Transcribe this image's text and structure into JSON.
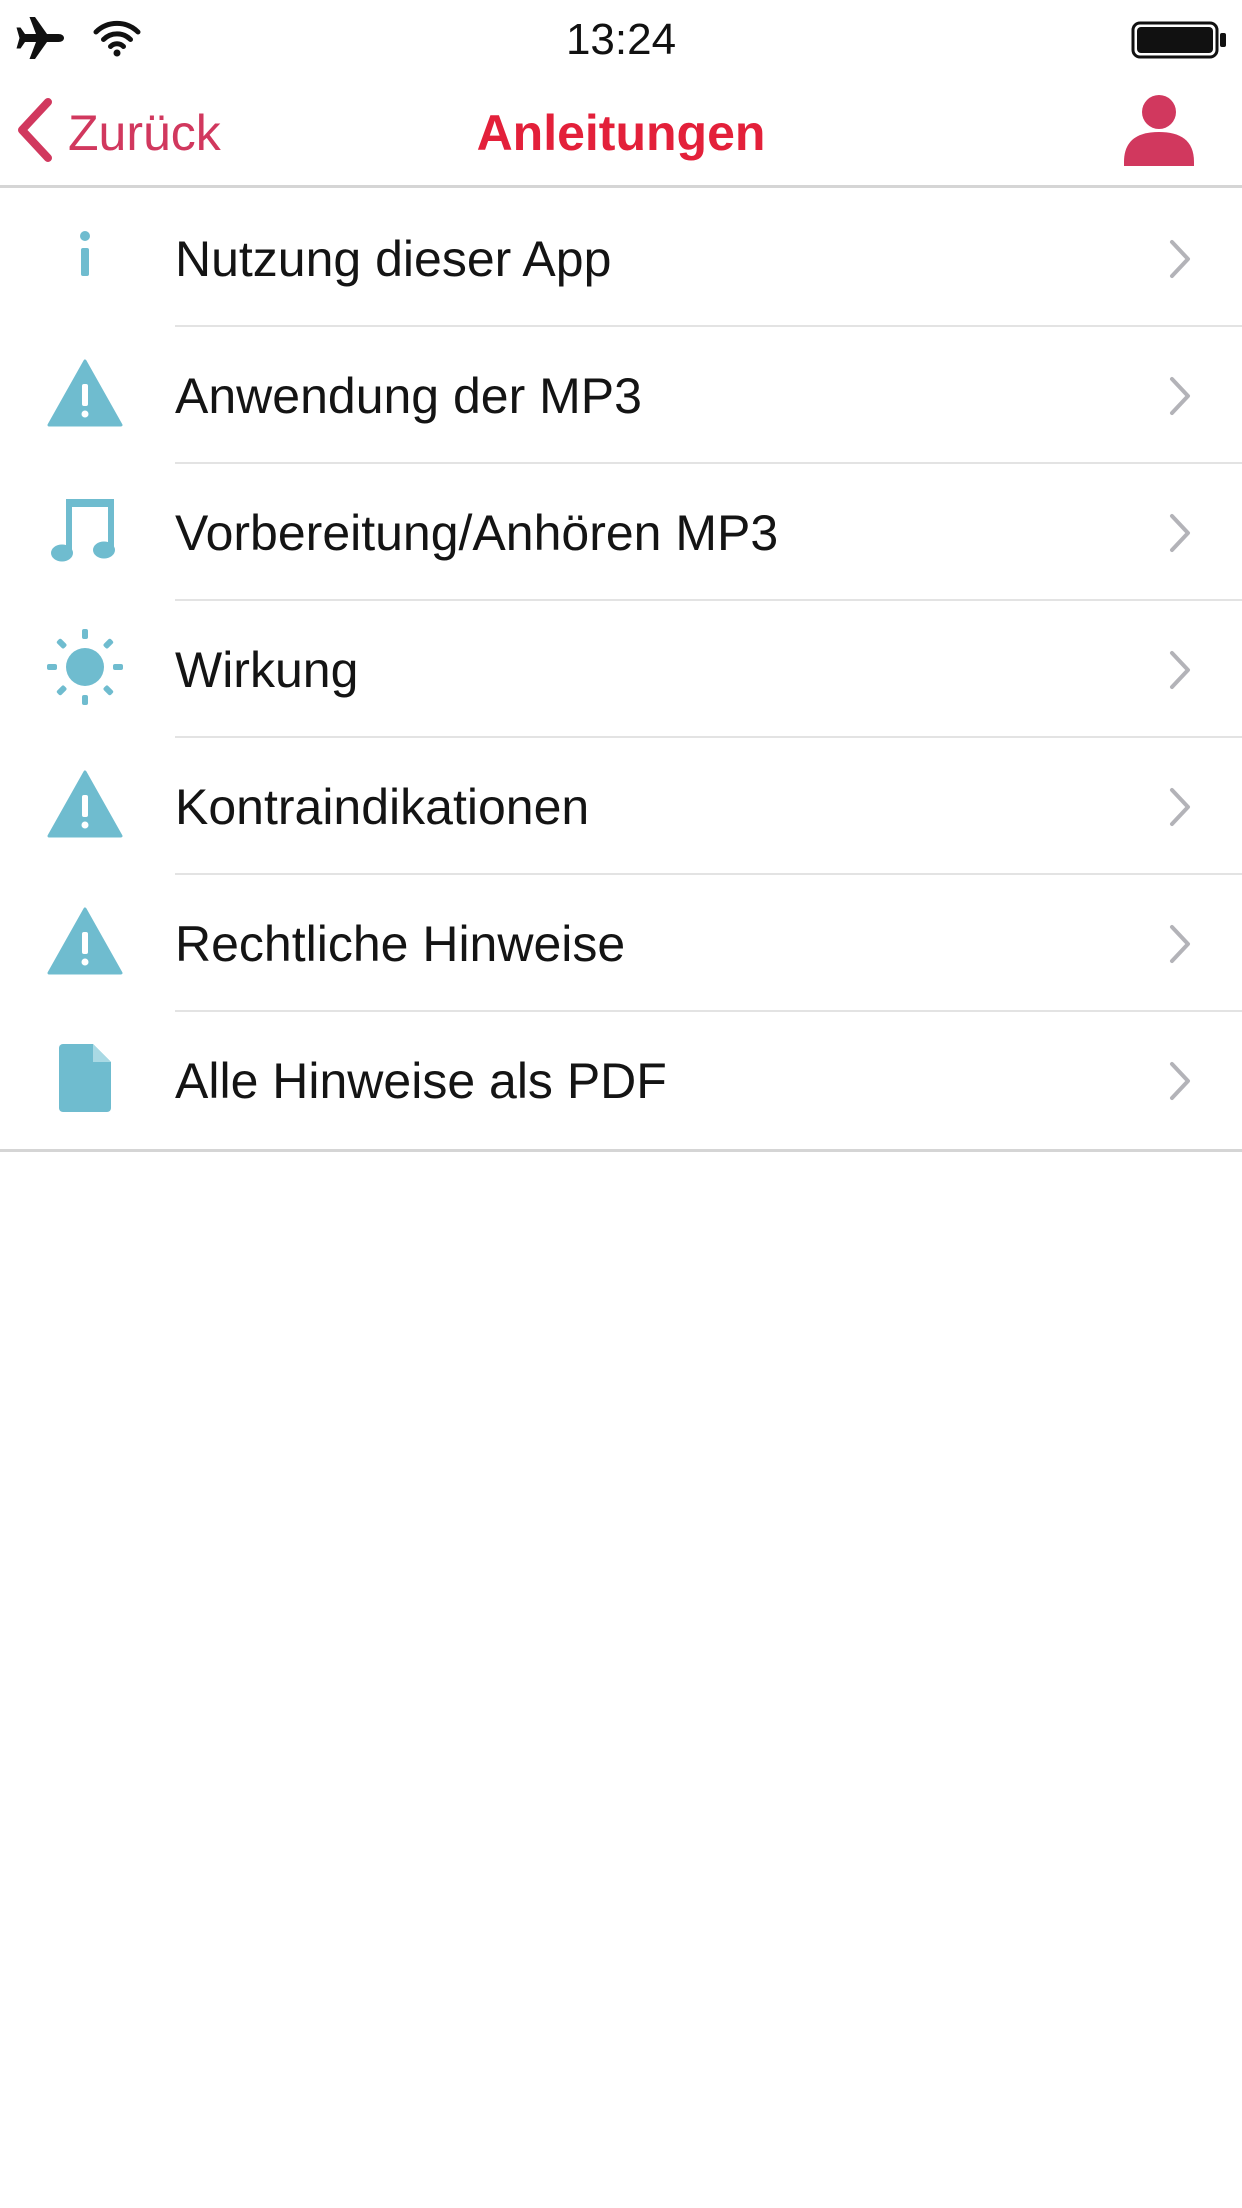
{
  "colors": {
    "accent": "#e3203a",
    "back": "#d1385e",
    "icon": "#6fbccf",
    "chevron": "#b3b3b8",
    "separator": "#e3e3e3"
  },
  "status_bar": {
    "time": "13:24",
    "icons": [
      "airplane-icon",
      "wifi-icon",
      "battery-icon"
    ]
  },
  "nav": {
    "back_label": "Zurück",
    "title": "Anleitungen",
    "profile_icon": "user-icon"
  },
  "menu": {
    "items": [
      {
        "label": "Nutzung dieser App",
        "icon": "info-icon"
      },
      {
        "label": "Anwendung der MP3",
        "icon": "warning-icon"
      },
      {
        "label": "Vorbereitung/Anhören MP3",
        "icon": "music-note-icon"
      },
      {
        "label": "Wirkung",
        "icon": "sun-icon"
      },
      {
        "label": "Kontraindikationen",
        "icon": "warning-icon"
      },
      {
        "label": "Rechtliche Hinweise",
        "icon": "warning-icon"
      },
      {
        "label": "Alle Hinweise als PDF",
        "icon": "document-icon"
      }
    ]
  }
}
